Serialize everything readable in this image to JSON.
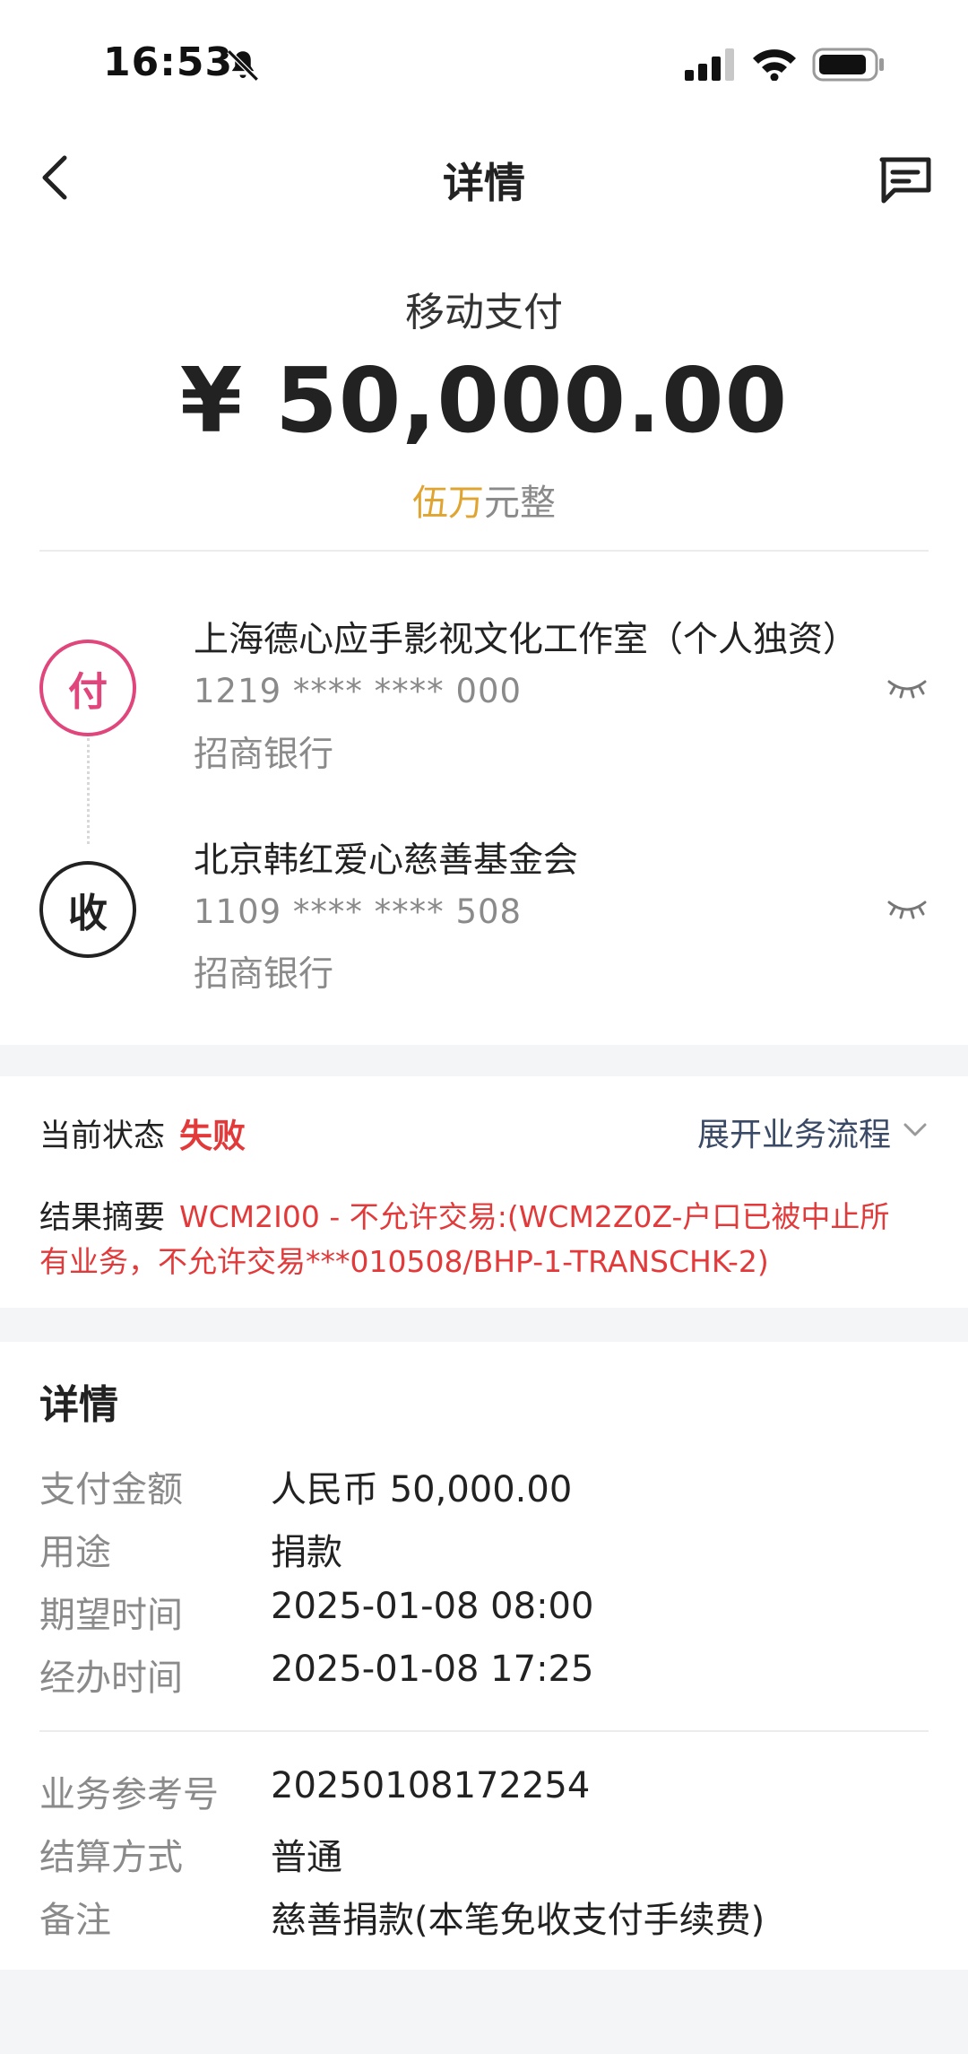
{
  "status_bar": {
    "time": "16:53"
  },
  "nav": {
    "title": "详情"
  },
  "summary": {
    "pay_type": "移动支付",
    "amount": "¥ 50,000.00",
    "amount_cn_highlight": "伍万",
    "amount_cn_rest": "元整"
  },
  "payer": {
    "badge": "付",
    "name": "上海德心应手影视文化工作室（个人独资）",
    "account": "1219 **** **** 000",
    "bank": "招商银行"
  },
  "payee": {
    "badge": "收",
    "name": "北京韩红爱心慈善基金会",
    "account": "1109 **** **** 508",
    "bank": "招商银行"
  },
  "status": {
    "label": "当前状态",
    "value": "失败",
    "expand_label": "展开业务流程",
    "summary_label": "结果摘要",
    "summary_line1": "WCM2I00 - 不允许交易:(WCM2Z0Z-户口已被中止所",
    "summary_line2": "有业务，不允许交易***010508/BHP-1-TRANSCHK-2)"
  },
  "details": {
    "title": "详情",
    "rows": [
      {
        "label": "支付金额",
        "value": "人民币 50,000.00"
      },
      {
        "label": "用途",
        "value": "捐款"
      },
      {
        "label": "期望时间",
        "value": "2025-01-08 08:00"
      },
      {
        "label": "经办时间",
        "value": "2025-01-08 17:25"
      },
      {
        "label": "业务参考号",
        "value": "20250108172254"
      },
      {
        "label": "结算方式",
        "value": "普通"
      },
      {
        "label": "备注",
        "value": "慈善捐款(本笔免收支付手续费)"
      }
    ]
  },
  "colors": {
    "payer_badge": "#e0457b",
    "payee_badge": "#222222",
    "fail_red": "#e23a3a",
    "amount_gold": "#e0a431",
    "expand_blue": "#3a4a66"
  },
  "icons": {
    "back": "back-chevron-icon",
    "message": "message-icon",
    "mute": "bell-off-icon",
    "signal": "signal-icon",
    "wifi": "wifi-icon",
    "battery": "battery-icon",
    "eye": "eye-closed-icon",
    "expand": "chevron-down-icon"
  }
}
